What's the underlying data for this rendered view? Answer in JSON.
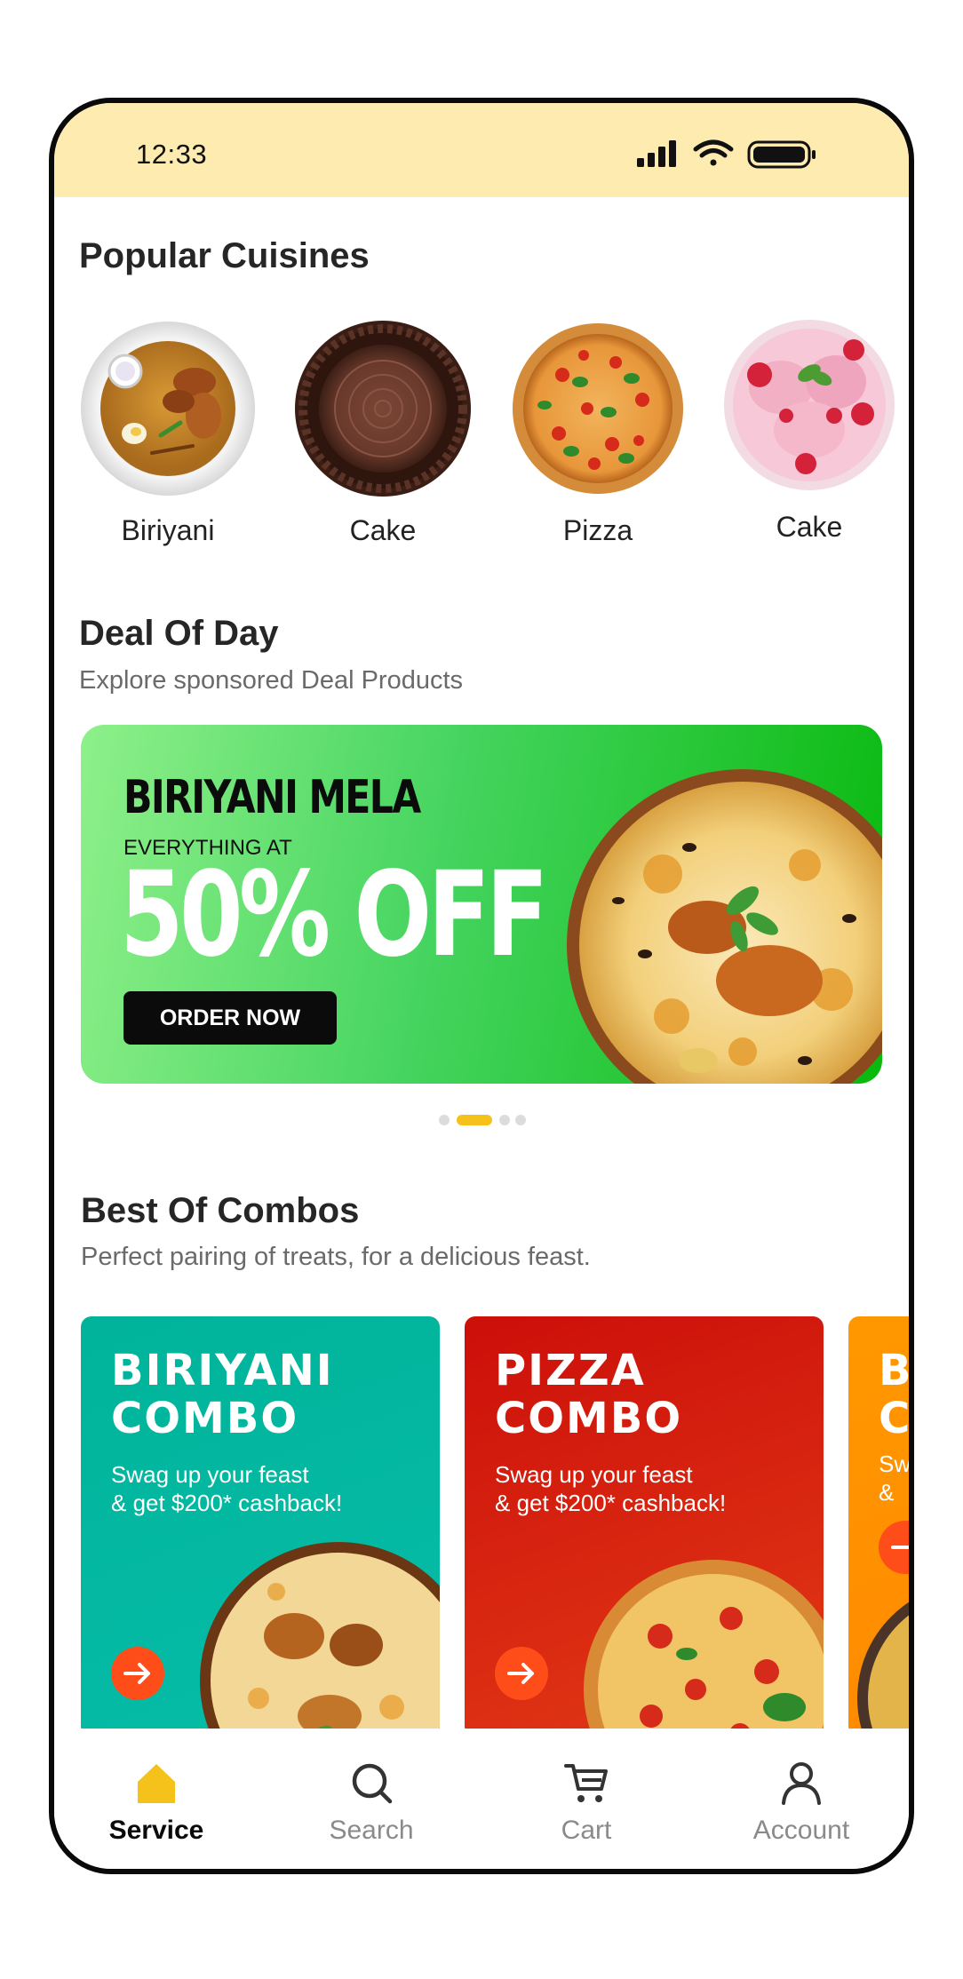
{
  "status_bar": {
    "time": "12:33"
  },
  "popular": {
    "title": "Popular Cuisines",
    "items": [
      {
        "label": "Biriyani",
        "icon": "biriyani-plate-image"
      },
      {
        "label": "Cake",
        "icon": "chocolate-cake-image"
      },
      {
        "label": "Pizza",
        "icon": "pizza-image"
      },
      {
        "label": "Cake",
        "icon": "strawberry-ice-cream-image"
      }
    ]
  },
  "deal": {
    "title": "Deal Of Day",
    "subtitle": "Explore sponsored Deal Products",
    "banner": {
      "headline": "BIRIYANI MELA",
      "tagline": "EVERYTHING AT",
      "offer": "50% OFF",
      "button": "ORDER NOW"
    },
    "carousel_active_index": 1,
    "carousel_count": 4
  },
  "combos": {
    "title": "Best Of Combos",
    "subtitle": "Perfect pairing of treats, for a delicious feast.",
    "items": [
      {
        "title": "BIRIYANI\nCOMBO",
        "desc": "Swag up your feast\n& get $200* cashback!",
        "color": "#00b39a"
      },
      {
        "title": "PIZZA\nCOMBO",
        "desc": "Swag up your feast\n& get $200* cashback!",
        "color": "#d21509"
      },
      {
        "title": "B\nC",
        "desc": "Sw\n&",
        "color": "#ff9800"
      }
    ]
  },
  "nav": {
    "active": "Service",
    "items": [
      {
        "label": "Service",
        "icon": "home-icon"
      },
      {
        "label": "Search",
        "icon": "search-icon"
      },
      {
        "label": "Cart",
        "icon": "cart-icon"
      },
      {
        "label": "Account",
        "icon": "account-icon"
      }
    ]
  },
  "colors": {
    "accent": "#f5c21b",
    "status_bar": "#fdebb0",
    "arrow_button": "#ff4d1a"
  }
}
